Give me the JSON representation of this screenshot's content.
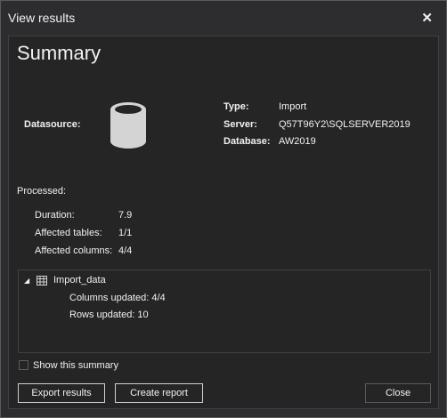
{
  "window": {
    "title": "View results",
    "close_glyph": "✕"
  },
  "summary": {
    "heading": "Summary"
  },
  "datasource": {
    "label": "Datasource:",
    "icon": "database-icon",
    "type_label": "Type:",
    "type_value": "Import",
    "server_label": "Server:",
    "server_value": "Q57T96Y2\\SQLSERVER2019",
    "database_label": "Database:",
    "database_value": "AW2019"
  },
  "processed": {
    "label": "Processed:",
    "duration_label": "Duration:",
    "duration_value": "7.9",
    "tables_label": "Affected tables:",
    "tables_value": "1/1",
    "columns_label": "Affected columns:",
    "columns_value": "4/4"
  },
  "results": {
    "node_label": "Import_data",
    "expander_glyph": "◢",
    "columns_updated": "Columns updated: 4/4",
    "rows_updated": "Rows updated: 10"
  },
  "footer": {
    "show_summary_label": "Show this summary",
    "show_summary_checked": false,
    "export_label": "Export results",
    "report_label": "Create report",
    "close_label": "Close"
  }
}
